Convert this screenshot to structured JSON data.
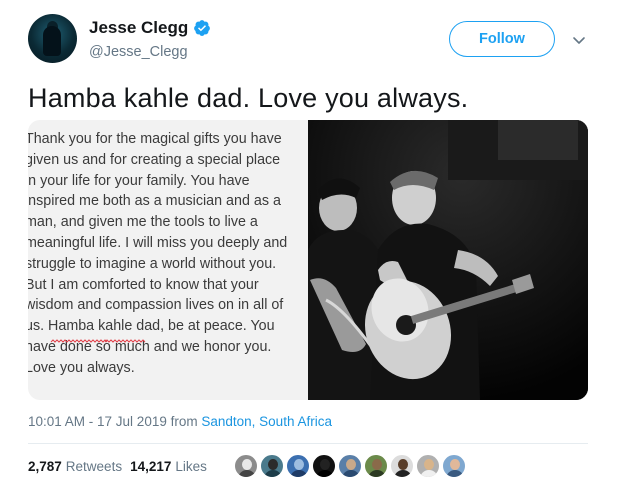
{
  "user": {
    "display_name": "Jesse Clegg",
    "handle": "@Jesse_Clegg",
    "verified": true,
    "follow_label": "Follow"
  },
  "tweet": {
    "text": "Hamba kahle dad. Love you always.",
    "letter_lines": [
      "Thank you for the magical gifts you have",
      "given us and for creating a special place",
      "in your life for your family. You have",
      "inspired me both as a musician and as a",
      "man, and given me the tools to live a",
      "meaningful life. I will miss you deeply and",
      "struggle to imagine a world without you.",
      "But I am comforted to know that your",
      "wisdom and compassion lives on in all of",
      "us. Hamba kahle dad, be at peace. You",
      "have done so much and we honor you.",
      "Love you always."
    ],
    "time": "10:01 AM - 17 Jul 2019",
    "from_label": "from",
    "location": "Sandton, South Africa"
  },
  "stats": {
    "retweets_count": "2,787",
    "retweets_label": "Retweets",
    "likes_count": "14,217",
    "likes_label": "Likes"
  },
  "colors": {
    "accent": "#1da1f2",
    "link": "#1b95e0",
    "muted": "#657786",
    "text": "#14171a"
  },
  "icons": {
    "verified": "verified-badge-icon",
    "menu": "chevron-down-icon"
  }
}
